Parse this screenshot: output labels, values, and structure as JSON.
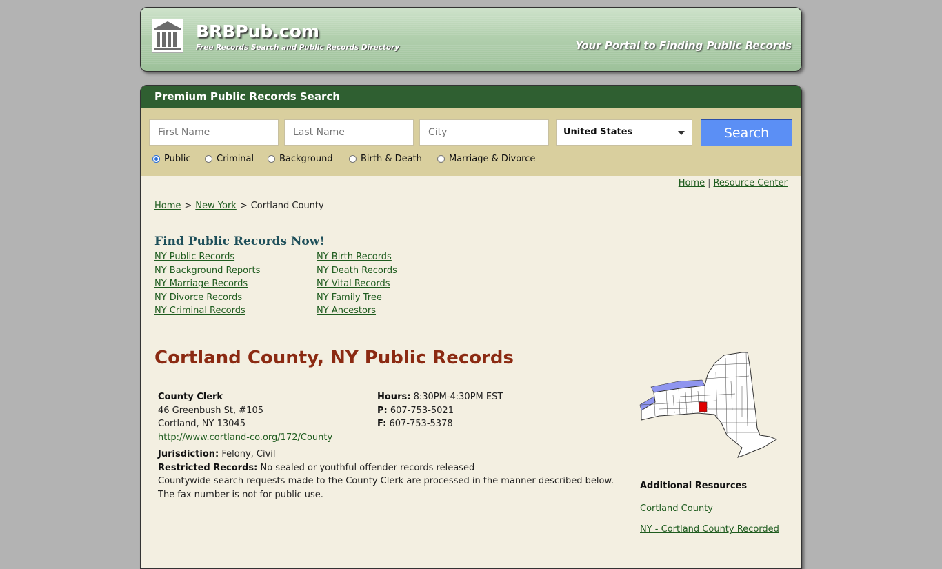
{
  "header": {
    "site_name": "BRBPub.com",
    "tagline": "Free Records Search and Public Records Directory",
    "portal_text": "Your Portal to Finding Public Records"
  },
  "search": {
    "title": "Premium Public Records Search",
    "first_name_placeholder": "First Name",
    "last_name_placeholder": "Last Name",
    "city_placeholder": "City",
    "country_selected": "United States",
    "button_label": "Search",
    "radio_options": [
      {
        "label": "Public",
        "checked": true
      },
      {
        "label": "Criminal",
        "checked": false
      },
      {
        "label": "Background",
        "checked": false
      },
      {
        "label": "Birth & Death",
        "checked": false
      },
      {
        "label": "Marriage & Divorce",
        "checked": false
      }
    ]
  },
  "top_links": {
    "home": "Home",
    "sep": "|",
    "resource_center": "Resource Center"
  },
  "breadcrumb": {
    "home": "Home",
    "sep": ">",
    "state": "New York",
    "current": "Cortland County"
  },
  "find": {
    "title": "Find Public Records Now!",
    "left_links": [
      "NY Public Records",
      "NY Background Reports",
      "NY Marriage Records",
      "NY Divorce Records",
      "NY Criminal Records"
    ],
    "right_links": [
      "NY Birth Records",
      "NY Death Records",
      "NY Vital Records",
      "NY Family Tree",
      "NY Ancestors"
    ]
  },
  "page_title": "Cortland County, NY Public Records",
  "clerk": {
    "name": "County Clerk",
    "address1": "46 Greenbush St, #105",
    "address2": "Cortland, NY 13045",
    "url": "http://www.cortland-co.org/172/County",
    "hours_label": "Hours:",
    "hours": "8:30PM-4:30PM EST",
    "phone_label": "P:",
    "phone": "607-753-5021",
    "fax_label": "F:",
    "fax": "607-753-5378",
    "jurisdiction_label": "Jurisdiction:",
    "jurisdiction": "Felony, Civil",
    "restricted_label": "Restricted Records:",
    "restricted": "No sealed or youthful offender records released",
    "note1": "Countywide search requests made to the County Clerk are processed in the manner described below.",
    "note2": "The fax number is not for public use."
  },
  "sidebar": {
    "additional_title": "Additional Resources",
    "links": [
      "Cortland County",
      "NY - Cortland County Recorded"
    ]
  },
  "colors": {
    "panel_bg": "#f3efe1",
    "search_head": "#2f5f31",
    "search_area": "#d9cf9e",
    "title_red": "#8b2a12",
    "link_green": "#1f5c1f",
    "map_highlight": "#e00000",
    "lake_blue": "#8f95ef"
  }
}
